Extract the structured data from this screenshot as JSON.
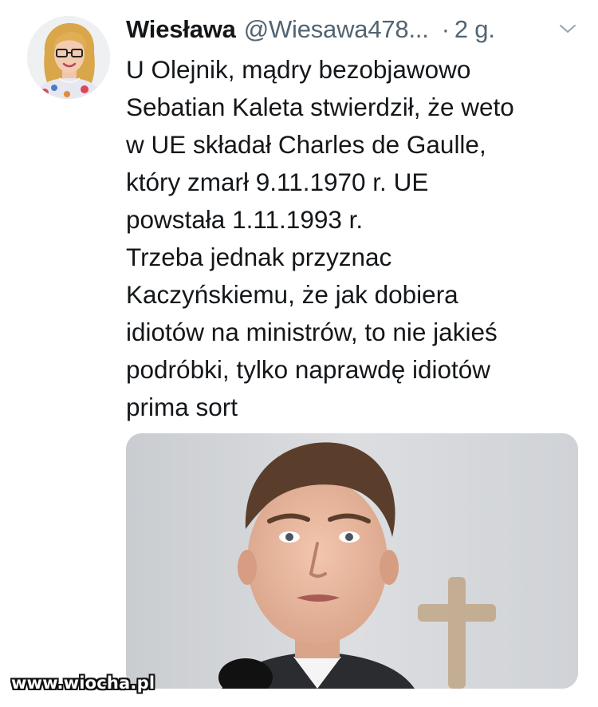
{
  "tweet": {
    "author": {
      "display_name": "Wiesława",
      "handle": "@Wiesawa478...",
      "avatar_icon": "profile-photo"
    },
    "separator": "·",
    "time": "2 g.",
    "menu_icon": "chevron-down-icon",
    "text_lines": [
      "U Olejnik, mądry bezobjawowo",
      "Sebatian Kaleta stwierdził, że weto",
      "w UE składał Charles de Gaulle,",
      "który zmarł 9.11.1970 r. UE",
      "powstała 1.11.1993 r.",
      "Trzeba jednak przyznac",
      "Kaczyńskiemu, że jak dobiera",
      "idiotów na ministrów, to nie jakieś",
      "podróbki, tylko naprawdę idiotów",
      "prima sort"
    ],
    "media": {
      "type": "photo"
    }
  },
  "watermark": "www.wiocha.pl",
  "colors": {
    "text": "#14171a",
    "muted": "#536471",
    "background": "#ffffff"
  }
}
